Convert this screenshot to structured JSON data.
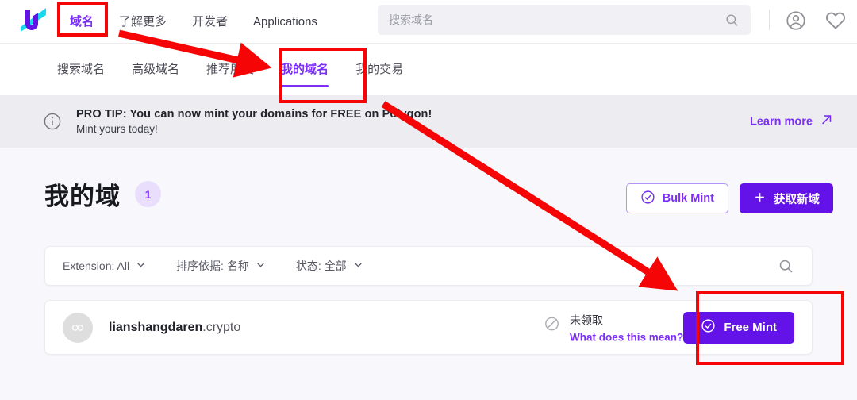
{
  "header": {
    "logo_alt": "unstoppable-domains-logo",
    "nav": [
      {
        "label": "域名",
        "active": true
      },
      {
        "label": "了解更多",
        "active": false
      },
      {
        "label": "开发者",
        "active": false
      },
      {
        "label": "Applications",
        "active": false
      }
    ],
    "search": {
      "placeholder": "搜索域名",
      "value": ""
    },
    "icons": {
      "search": "search-icon",
      "account": "account-icon",
      "favorites": "heart-icon"
    }
  },
  "subnav": {
    "tabs": [
      {
        "label": "搜索域名",
        "active": false
      },
      {
        "label": "高级域名",
        "active": false
      },
      {
        "label": "推荐朋友",
        "active": false
      },
      {
        "label": "我的域名",
        "active": true
      },
      {
        "label": "我的交易",
        "active": false
      }
    ]
  },
  "banner": {
    "icon": "info-icon",
    "title": "PRO TIP: You can now mint your domains for FREE on Polygon!",
    "subtitle": "Mint yours today!",
    "link_label": "Learn more",
    "link_icon": "external-link-icon"
  },
  "page": {
    "title": "我的域",
    "count": "1",
    "bulk_mint_label": "Bulk Mint",
    "bulk_mint_icon": "check-circle-icon",
    "get_new_label": "获取新域",
    "get_new_icon": "plus-icon"
  },
  "filters": {
    "items": [
      {
        "label": "Extension: All"
      },
      {
        "label": "排序依据: 名称"
      },
      {
        "label": "状态: 全部"
      }
    ],
    "chevron_icon": "chevron-down-icon",
    "search_icon": "search-icon"
  },
  "domains": [
    {
      "avatar_icon": "polygon-icon",
      "name": "lianshangdaren",
      "extension": ".crypto",
      "status_icon": "not-claimed-icon",
      "status_label": "未领取",
      "status_link": "What does this mean?",
      "action_label": "Free Mint",
      "action_icon": "check-circle-icon"
    }
  ],
  "colors": {
    "brand_purple": "#7b2ff7",
    "button_purple": "#6313e8",
    "annotation_red": "#f50505",
    "page_background": "#f8f8fc",
    "banner_background": "#ececf1"
  },
  "annotations": {
    "boxes": [
      {
        "name": "highlight-domains-nav"
      },
      {
        "name": "highlight-my-domains-tab"
      },
      {
        "name": "highlight-free-mint-button"
      }
    ],
    "arrows": [
      {
        "name": "arrow-to-my-domains-tab"
      },
      {
        "name": "arrow-to-free-mint-button"
      }
    ]
  }
}
